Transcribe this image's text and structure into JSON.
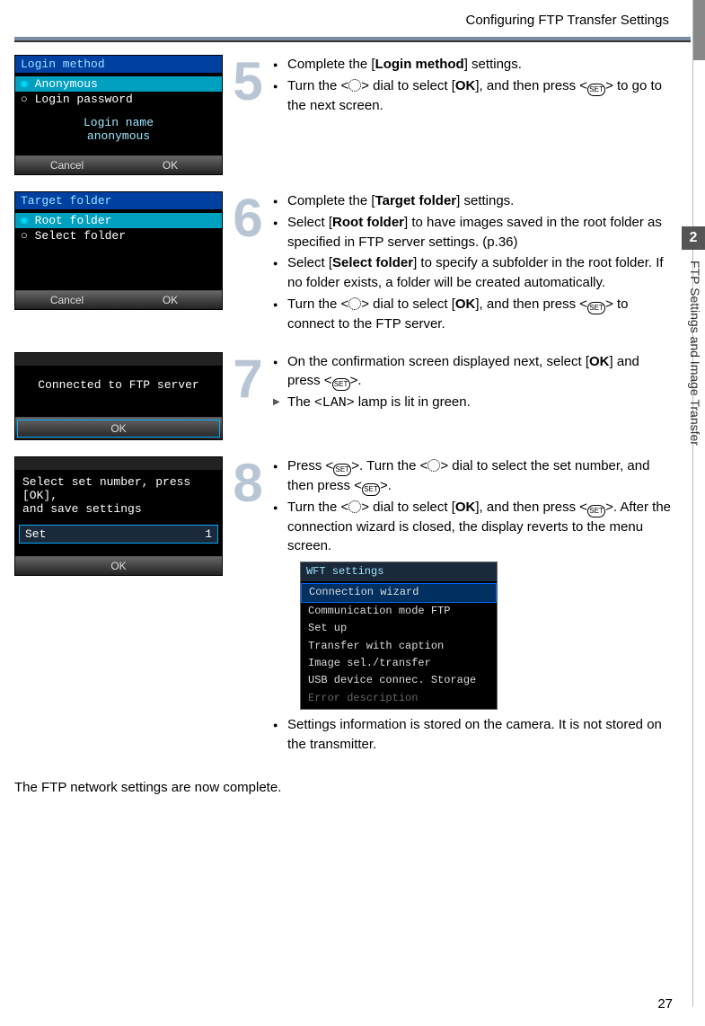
{
  "header": "Configuring FTP Transfer Settings",
  "chapterTab": "2",
  "sideLabel": "FTP Settings and Image Transfer",
  "pageNumber": "27",
  "step5": {
    "num": "5",
    "shot": {
      "title": "Login method",
      "opt1": "Anonymous",
      "opt2": "Login password",
      "centerLabel": "Login name",
      "centerValue": "anonymous",
      "cancel": "Cancel",
      "ok": "OK"
    },
    "b1a": "Complete the [",
    "b1bold": "Login method",
    "b1b": "] settings.",
    "b2a": "Turn the <",
    "b2b": "> dial to select [",
    "b2bold": "OK",
    "b2c": "], and then press <",
    "b2d": "> to go to the next screen."
  },
  "step6": {
    "num": "6",
    "shot": {
      "title": "Target folder",
      "opt1": "Root folder",
      "opt2": "Select folder",
      "cancel": "Cancel",
      "ok": "OK"
    },
    "b1a": "Complete the [",
    "b1bold": "Target folder",
    "b1b": "] settings.",
    "b2a": "Select [",
    "b2bold": "Root folder",
    "b2b": "] to have images saved in the root folder as specified in FTP server settings. (p.36)",
    "b3a": "Select [",
    "b3bold": "Select folder",
    "b3b": "] to specify a subfolder in the root folder. If no folder exists, a folder will be created automatically.",
    "b4a": "Turn the <",
    "b4b": "> dial to select [",
    "b4bold": "OK",
    "b4c": "], and then press <",
    "b4d": "> to connect to the FTP server."
  },
  "step7": {
    "num": "7",
    "shot": {
      "msg": "Connected to FTP server",
      "ok": "OK"
    },
    "b1a": "On the confirmation screen displayed next, select [",
    "b1bold": "OK",
    "b1b": "] and press <",
    "b1c": ">.",
    "b2a": "The <",
    "b2mono": "LAN",
    "b2b": "> lamp is lit in green."
  },
  "step8": {
    "num": "8",
    "shot": {
      "line1": "Select set number, press [OK],",
      "line2": "and save settings",
      "setLabel": "Set",
      "setVal": "1",
      "ok": "OK"
    },
    "b1a": "Press <",
    "b1b": ">. Turn the <",
    "b1c": "> dial to select the set number, and then press <",
    "b1d": ">.",
    "b2a": "Turn the <",
    "b2b": "> dial to select [",
    "b2bold": "OK",
    "b2c": "], and then press <",
    "b2d": ">. After the connection wizard is closed, the display reverts to the menu screen.",
    "inset": {
      "title": "WFT settings",
      "i1": "Connection wizard",
      "i2": "Communication mode FTP",
      "i3": "Set up",
      "i4": "Transfer with caption",
      "i5": "Image sel./transfer",
      "i6": "USB device connec. Storage",
      "i7": "Error description"
    },
    "b3": "Settings information is stored on the camera. It is not stored on the transmitter."
  },
  "footer": "The FTP network settings are now complete."
}
